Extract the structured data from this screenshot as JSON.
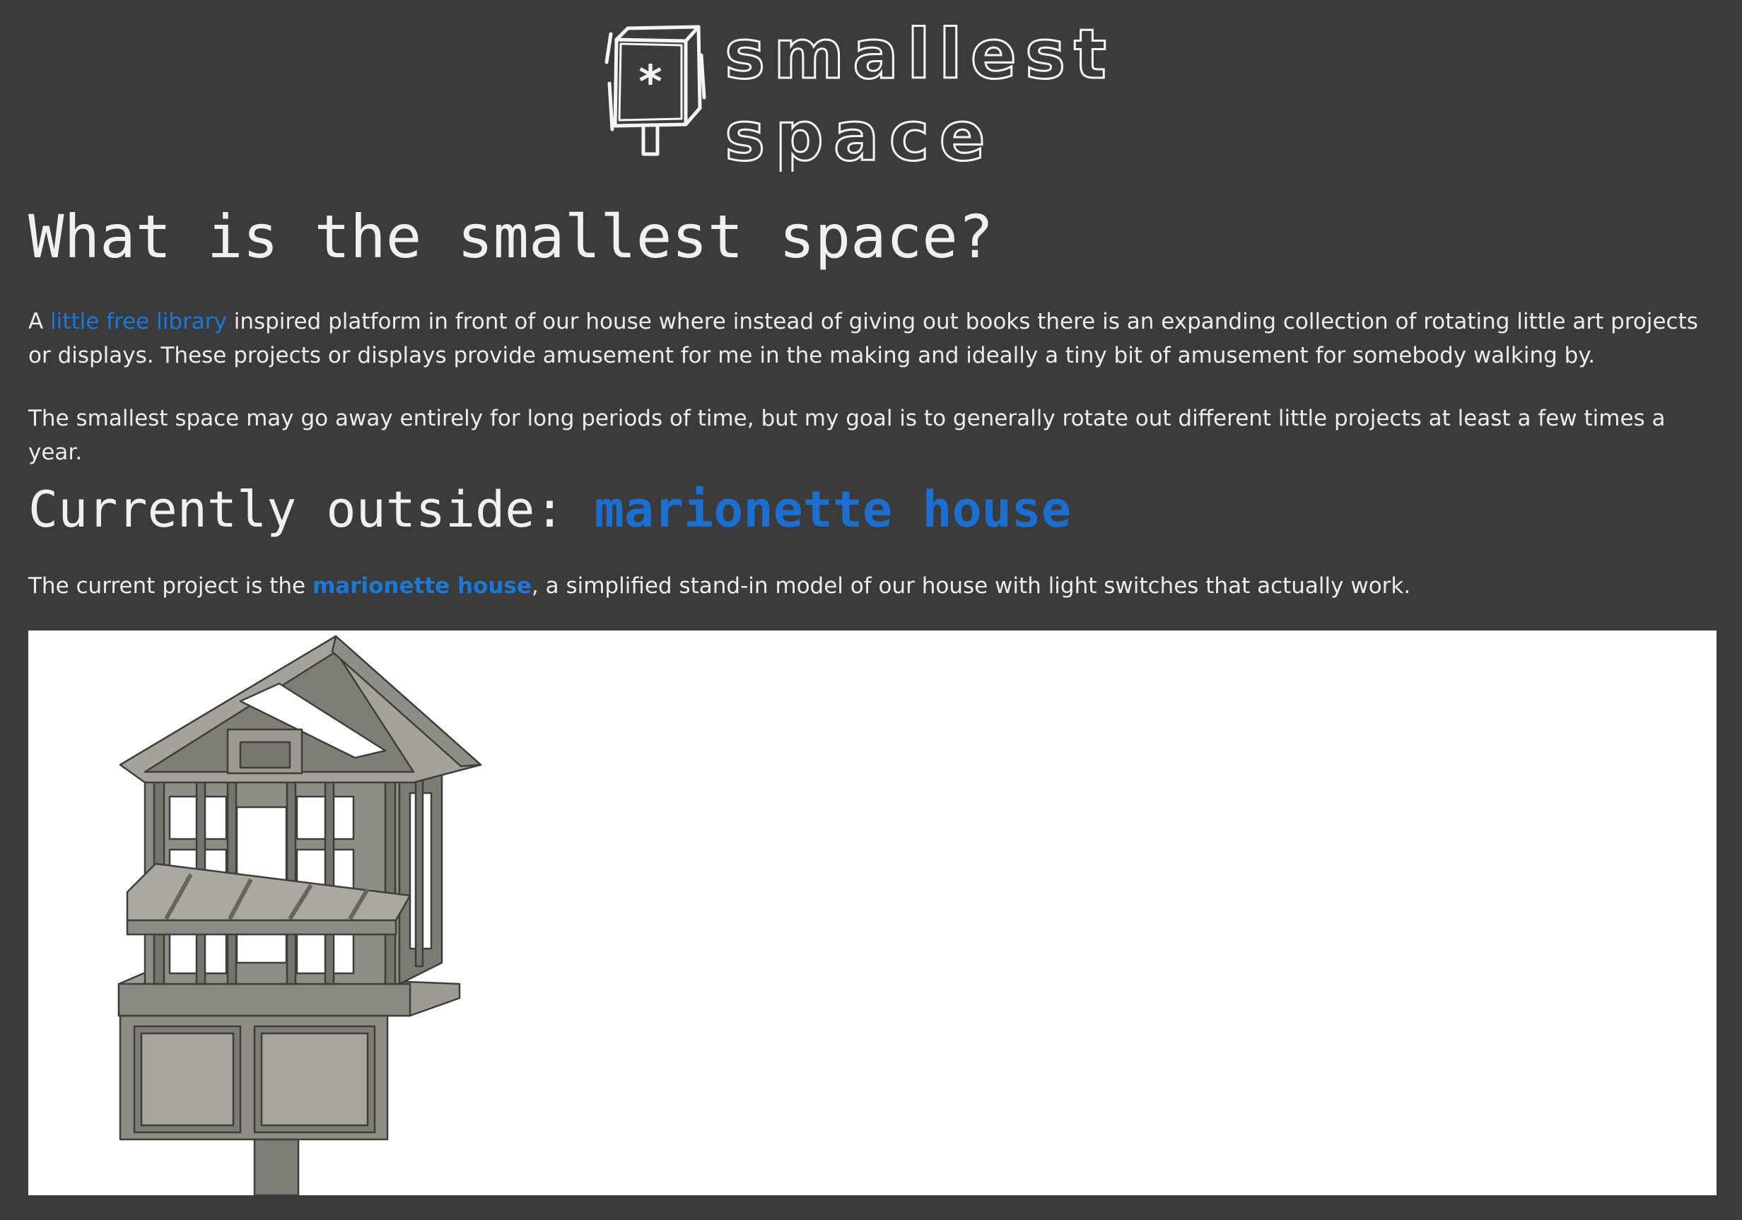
{
  "logo": {
    "line1": "smallest",
    "line2": "space",
    "box_glyph": "*"
  },
  "intro": {
    "heading": "What is the smallest space?",
    "p1_before": "A ",
    "p1_link": "little free library",
    "p1_after": " inspired platform in front of our house where instead of giving out books there is an expanding collection of rotating little art projects or displays. These projects or displays provide amusement for me in the making and ideally a tiny bit of amusement for somebody walking by.",
    "p2": "The smallest space may go away entirely for long periods of time, but my goal is to generally rotate out different little projects at least a few times a year."
  },
  "current": {
    "heading_prefix": "Currently outside: ",
    "heading_link": "marionette house",
    "p_before": "The current project is the ",
    "p_link": "marionette house",
    "p_after": ", a simplified stand-in model of our house with light switches that actually work."
  },
  "colors": {
    "background": "#3b3b3b",
    "text": "#ececec",
    "link": "#1a78d8",
    "model_gray": "#8a8a84"
  }
}
